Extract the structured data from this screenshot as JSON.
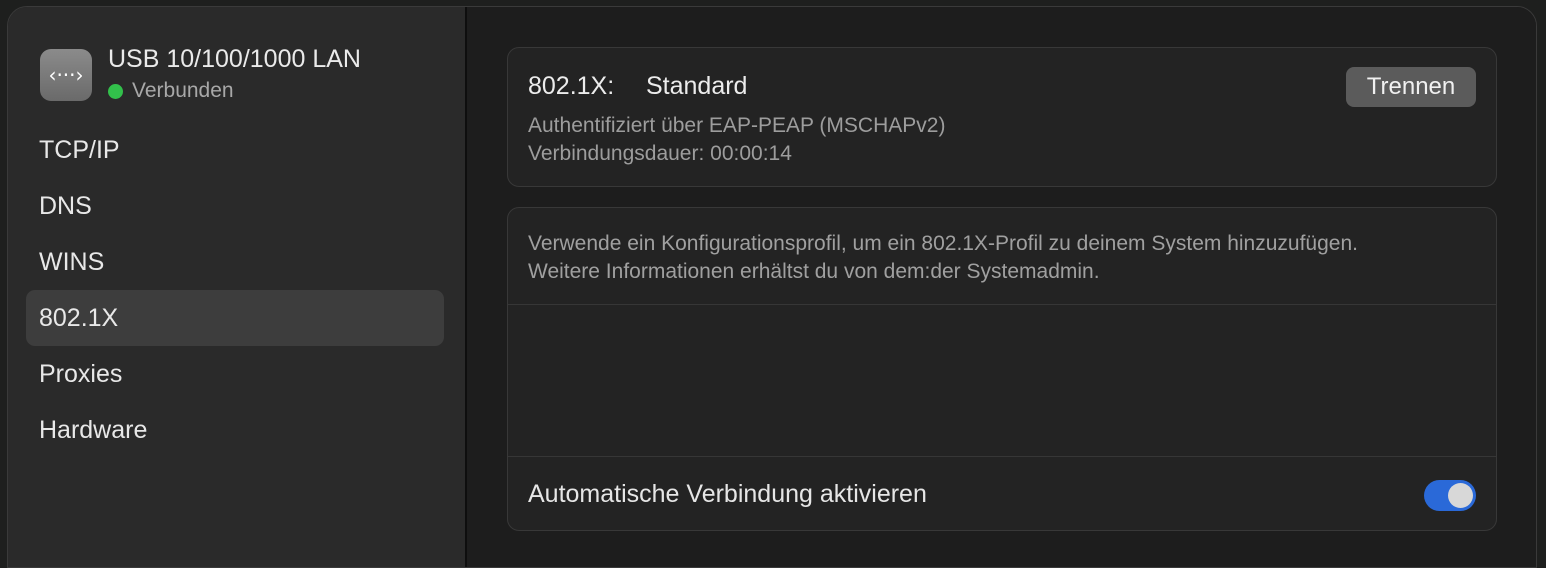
{
  "device": {
    "icon": "network-ethernet-icon",
    "icon_glyph": "‹···›",
    "name": "USB 10/100/1000 LAN",
    "status": "Verbunden",
    "status_color": "#32c04b"
  },
  "sidebar": {
    "items": [
      {
        "label": "TCP/IP"
      },
      {
        "label": "DNS"
      },
      {
        "label": "WINS"
      },
      {
        "label": "802.1X",
        "selected": true
      },
      {
        "label": "Proxies"
      },
      {
        "label": "Hardware"
      }
    ]
  },
  "connection": {
    "label": "802.1X:",
    "value": "Standard",
    "auth": "Authentifiziert über EAP-PEAP (MSCHAPv2)",
    "duration": "Verbindungsdauer: 00:00:14",
    "disconnect_label": "Trennen"
  },
  "profile": {
    "info_line1": "Verwende ein Konfigurationsprofil, um ein 802.1X-Profil zu deinem System hinzuzufügen.",
    "info_line2": "Weitere Informationen erhältst du von dem:der Systemadmin.",
    "auto_connect_label": "Automatische Verbindung aktivieren",
    "auto_connect_enabled": true,
    "toggle_color": "#2a69d8"
  }
}
